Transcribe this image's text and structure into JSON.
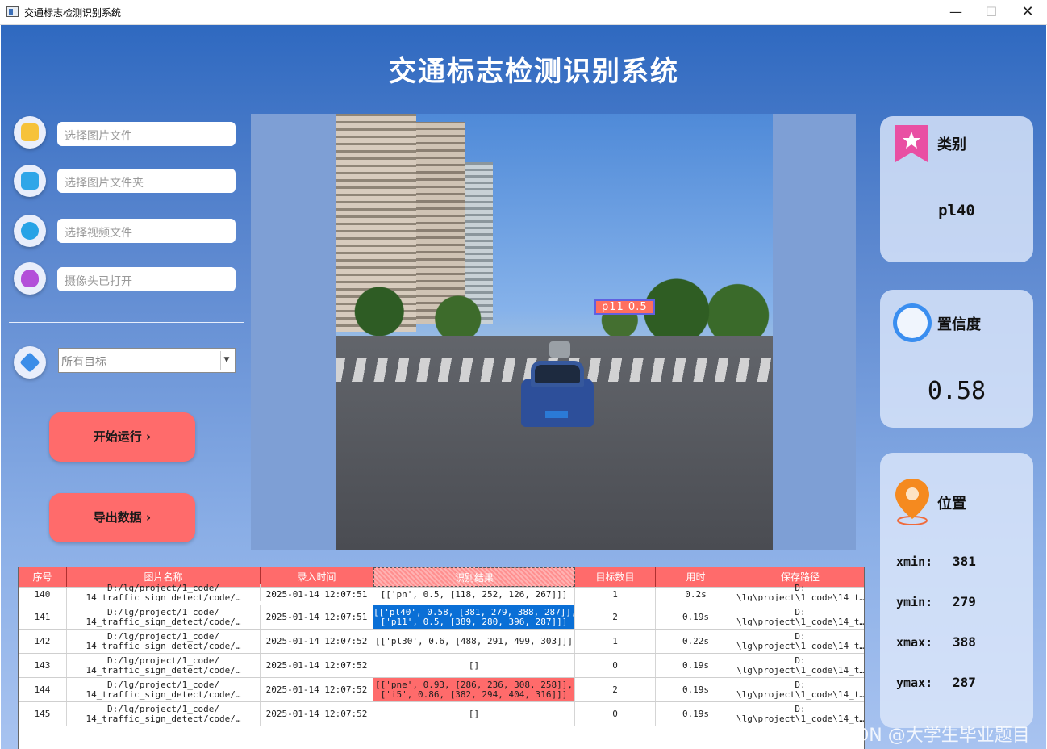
{
  "window": {
    "title": "交通标志检测识别系统",
    "controls": {
      "minimize": "—",
      "maximize": "☐",
      "close": "✕"
    }
  },
  "app_title": "交通标志检测识别系统",
  "inputs": {
    "image_file": "选择图片文件",
    "image_folder": "选择图片文件夹",
    "video_file": "选择视频文件",
    "camera": "摄像头已打开"
  },
  "target_select": {
    "selected": "所有目标",
    "arrow": "▼"
  },
  "buttons": {
    "start": "开始运行 ›",
    "export": "导出数据 ›"
  },
  "detection_overlay": {
    "label": "p11  0.5"
  },
  "cards": {
    "category": {
      "title": "类别",
      "value": "pl40"
    },
    "confidence": {
      "title": "置信度",
      "value": "0.58"
    },
    "position": {
      "title": "位置",
      "xmin_label": "xmin:",
      "xmin": "381",
      "ymin_label": "ymin:",
      "ymin": "279",
      "xmax_label": "xmax:",
      "xmax": "388",
      "ymax_label": "ymax:",
      "ymax": "287"
    }
  },
  "table": {
    "headers": [
      "序号",
      "图片名称",
      "录入时间",
      "识别结果",
      "目标数目",
      "用时",
      "保存路径"
    ],
    "rows": [
      {
        "id": "140",
        "name1": "D:/lg/project/1_code/",
        "name2": "14_traffic_sign_detect/code/…",
        "time": "2025-01-14 12:07:51",
        "res1": "[['pn', 0.5, [118, 252, 126, 267]]]",
        "res2": "",
        "count": "1",
        "cost": "0.2s",
        "path1": "D:",
        "path2": "\\lg\\project\\1_code\\14_t…"
      },
      {
        "id": "141",
        "name1": "D:/lg/project/1_code/",
        "name2": "14_traffic_sign_detect/code/…",
        "time": "2025-01-14 12:07:51",
        "res1": "[['pl40', 0.58, [381, 279, 388, 287]],",
        "res2": "['p11', 0.5, [389, 280, 396, 287]]]",
        "count": "2",
        "cost": "0.19s",
        "path1": "D:",
        "path2": "\\lg\\project\\1_code\\14_t…"
      },
      {
        "id": "142",
        "name1": "D:/lg/project/1_code/",
        "name2": "14_traffic_sign_detect/code/…",
        "time": "2025-01-14 12:07:52",
        "res1": "[['pl30', 0.6, [488, 291, 499, 303]]]",
        "res2": "",
        "count": "1",
        "cost": "0.22s",
        "path1": "D:",
        "path2": "\\lg\\project\\1_code\\14_t…"
      },
      {
        "id": "143",
        "name1": "D:/lg/project/1_code/",
        "name2": "14_traffic_sign_detect/code/…",
        "time": "2025-01-14 12:07:52",
        "res1": "[]",
        "res2": "",
        "count": "0",
        "cost": "0.19s",
        "path1": "D:",
        "path2": "\\lg\\project\\1_code\\14_t…"
      },
      {
        "id": "144",
        "name1": "D:/lg/project/1_code/",
        "name2": "14_traffic_sign_detect/code/…",
        "time": "2025-01-14 12:07:52",
        "res1": "[['pne', 0.93, [286, 236, 308, 258]],",
        "res2": "['i5', 0.86, [382, 294, 404, 316]]]",
        "count": "2",
        "cost": "0.19s",
        "path1": "D:",
        "path2": "\\lg\\project\\1_code\\14_t…"
      },
      {
        "id": "145",
        "name1": "D:/lg/project/1_code/",
        "name2": "14_traffic_sign_detect/code/…",
        "time": "2025-01-14 12:07:52",
        "res1": "[]",
        "res2": "",
        "count": "0",
        "cost": "0.19s",
        "path1": "D:",
        "path2": "\\lg\\project\\1_code\\14_t…"
      }
    ]
  },
  "watermark": "CSDN @大学生毕业题目",
  "colors": {
    "accent_red": "#ff6b6b",
    "selected_blue": "#0a6fd6",
    "bg_top": "#2f69c0",
    "bg_bottom": "#a8c3f0"
  }
}
